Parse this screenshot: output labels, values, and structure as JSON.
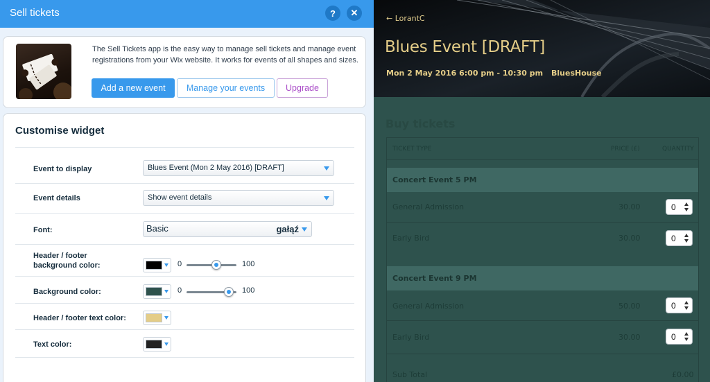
{
  "panel": {
    "title": "Sell tickets",
    "help_label": "?",
    "close_label": "✕",
    "intro": {
      "logo_icon": "tickets-icon",
      "description": "The Sell Tickets app is the easy way to manage sell tickets and manage event registrations from your Wix website. It works for events of all shapes and sizes.",
      "add_event_label": "Add a new event",
      "manage_events_label": "Manage your events",
      "upgrade_label": "Upgrade"
    },
    "customise": {
      "title": "Customise widget",
      "event_to_display": {
        "label": "Event to display",
        "value": "Blues Event (Mon 2 May 2016) [DRAFT]"
      },
      "event_details": {
        "label": "Event details",
        "value": "Show event details"
      },
      "font": {
        "label": "Font:",
        "value": "Basic",
        "sample": "gałąź"
      },
      "header_footer_bg": {
        "label_line1": "Header / footer",
        "label_line2": "background color:",
        "color": "#000000",
        "opacity_min": "0",
        "opacity_max": "100",
        "opacity_value": 60
      },
      "background": {
        "label": "Background color:",
        "color": "#2e524d",
        "opacity_min": "0",
        "opacity_max": "100",
        "opacity_value": 85
      },
      "header_footer_text": {
        "label": "Header / footer text color:",
        "color": "#e4cd88"
      },
      "text": {
        "label": "Text color:",
        "color": "#222222"
      }
    }
  },
  "preview": {
    "back_link": "← LorantC",
    "event_title": "Blues Event [DRAFT]",
    "datetime": "Mon 2 May 2016 6:00 pm - 10:30 pm",
    "venue": "BluesHouse",
    "buy_title": "Buy tickets",
    "columns": {
      "type": "TICKET TYPE",
      "price": "PRICE (£)",
      "quantity": "QUANTITY"
    },
    "groups": [
      {
        "name": "Concert Event 5 PM",
        "tickets": [
          {
            "name": "General Admission",
            "price": "30.00",
            "quantity": "0"
          },
          {
            "name": "Early Bird",
            "price": "30.00",
            "quantity": "0"
          }
        ]
      },
      {
        "name": "Concert Event 9 PM",
        "tickets": [
          {
            "name": "General Admission",
            "price": "50.00",
            "quantity": "0"
          },
          {
            "name": "Early Bird",
            "price": "30.00",
            "quantity": "0"
          }
        ]
      }
    ],
    "subtotal_label": "Sub Total",
    "subtotal_value": "£0.00"
  }
}
